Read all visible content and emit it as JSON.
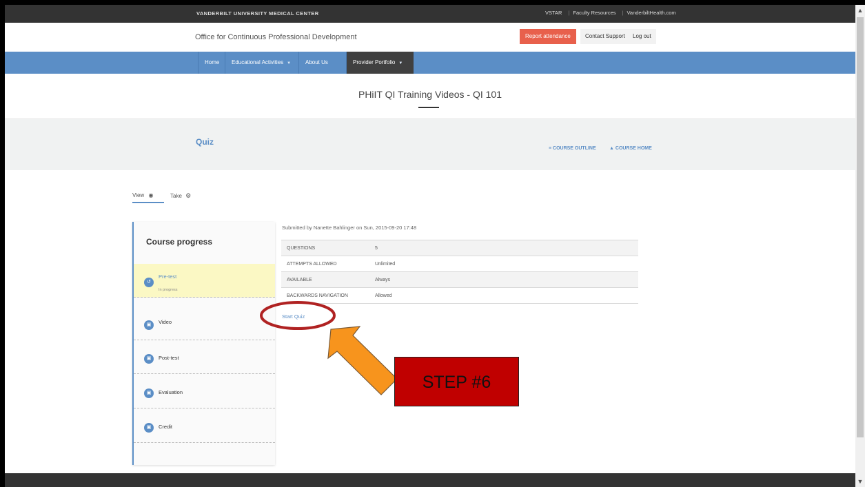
{
  "topbar": {
    "org": "VANDERBILT UNIVERSITY MEDICAL CENTER",
    "links": [
      "VSTAR",
      "Faculty Resources",
      "VanderbiltHealth.com"
    ]
  },
  "header": {
    "office": "Office for Continuous Professional Development",
    "report_attendance": "Report attendance",
    "contact_support": "Contact Support",
    "log_out": "Log out"
  },
  "nav": {
    "items": [
      {
        "label": "Home"
      },
      {
        "label": "Educational Activities"
      },
      {
        "label": "About Us"
      },
      {
        "label": "Provider Portfolio"
      }
    ]
  },
  "page": {
    "title": "PHiIT QI Training Videos - QI 101"
  },
  "band": {
    "heading": "Quiz",
    "course_outline": "≡ COURSE OUTLINE",
    "course_home": "COURSE HOME"
  },
  "tabs": {
    "view": "View",
    "take": "Take"
  },
  "progress": {
    "title": "Course progress",
    "items": [
      {
        "label": "Pre-test",
        "status": "In progress"
      },
      {
        "label": "Video"
      },
      {
        "label": "Post-test"
      },
      {
        "label": "Evaluation"
      },
      {
        "label": "Credit"
      }
    ]
  },
  "quiz": {
    "submitted": "Submitted by Nanette Bahlinger on Sun, 2015-09-20 17:48",
    "rows": [
      {
        "key": "QUESTIONS",
        "value": "5"
      },
      {
        "key": "ATTEMPTS ALLOWED",
        "value": "Unlimited"
      },
      {
        "key": "AVAILABLE",
        "value": "Always"
      },
      {
        "key": "BACKWARDS NAVIGATION",
        "value": "Allowed"
      }
    ],
    "start_label": "Start Quiz"
  },
  "annotation": {
    "step": "STEP #6"
  },
  "colors": {
    "accent": "#5b8ec6",
    "report_button": "#e8604c",
    "step_box": "#c00000",
    "arrow": "#f7941d",
    "circle": "#b02222"
  }
}
